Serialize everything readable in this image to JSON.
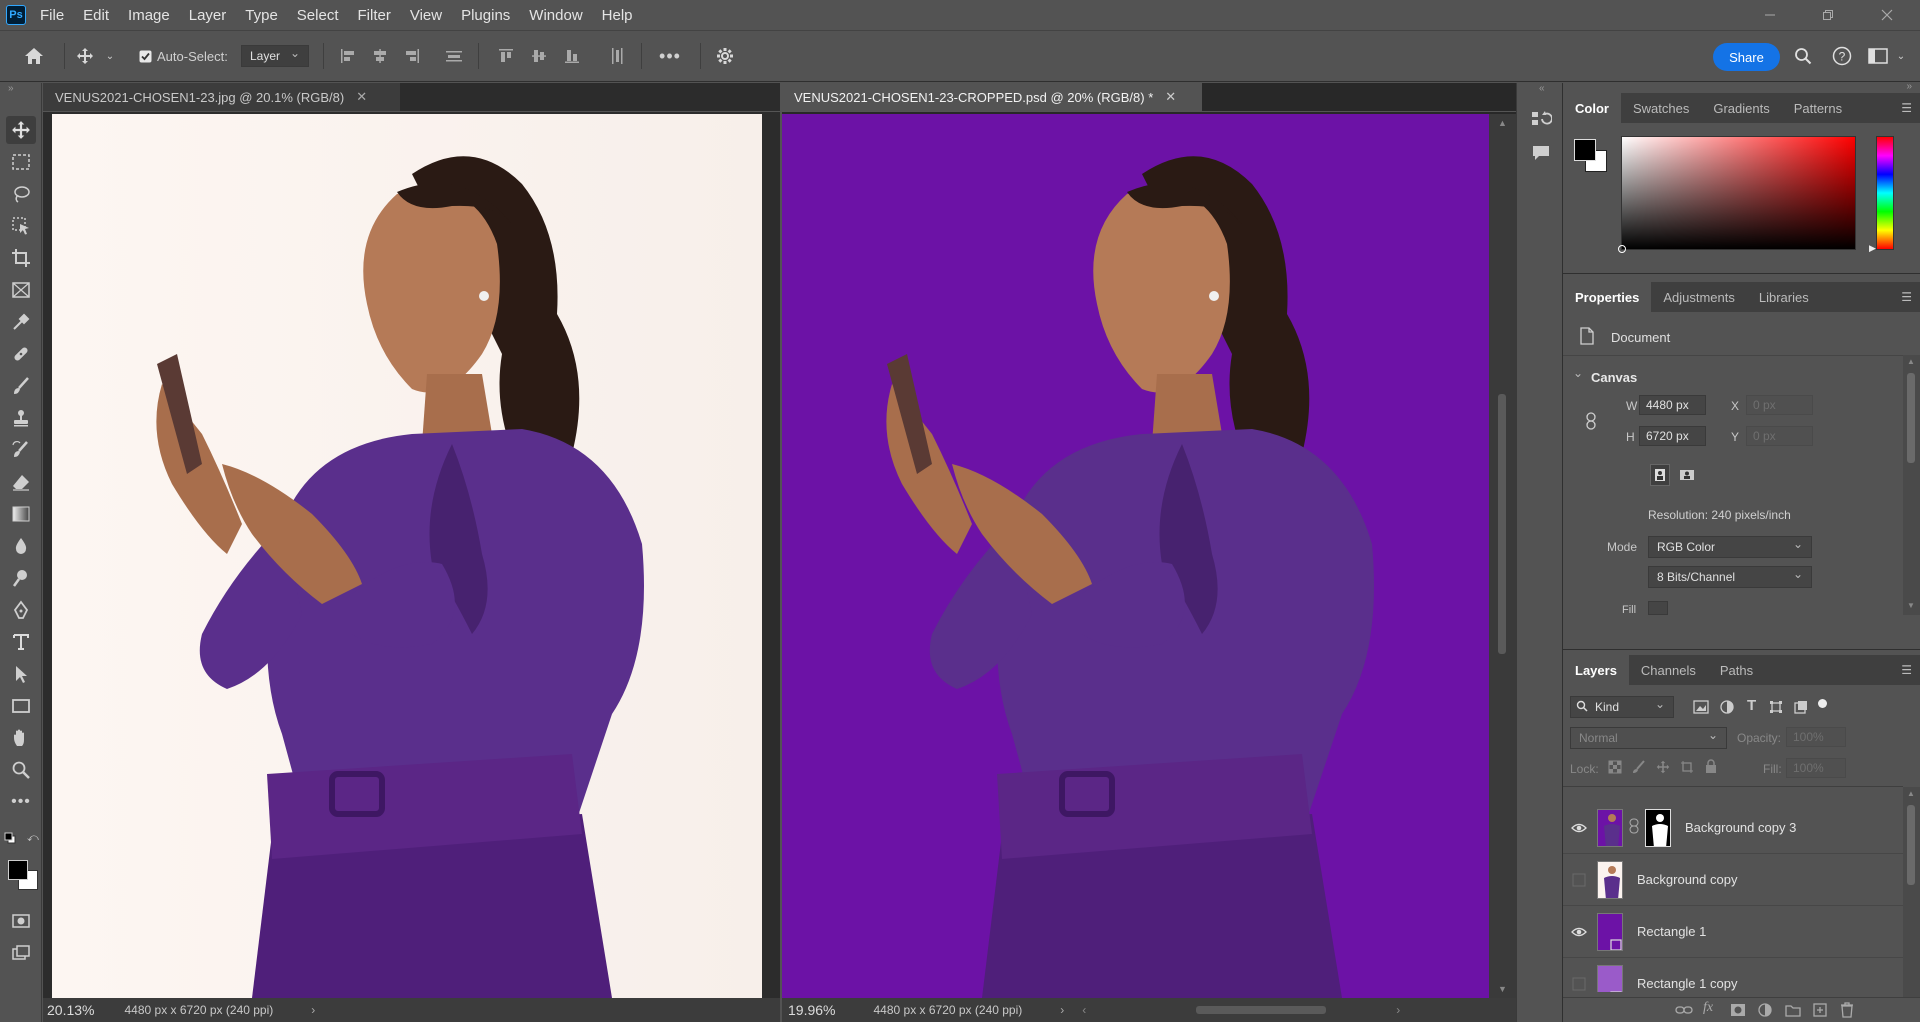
{
  "app": {
    "logo": "Ps"
  },
  "menu": [
    "File",
    "Edit",
    "Image",
    "Layer",
    "Type",
    "Select",
    "Filter",
    "View",
    "Plugins",
    "Window",
    "Help"
  ],
  "options_bar": {
    "auto_select_label": "Auto-Select:",
    "auto_select_checked": true,
    "auto_select_target": "Layer",
    "share_label": "Share"
  },
  "documents": [
    {
      "tab_title": "VENUS2021-CHOSEN1-23.jpg @ 20.1% (RGB/8)",
      "zoom": "20.13%",
      "info": "4480 px x 6720 px (240 ppi)",
      "active": false,
      "background": "#fbf3ef"
    },
    {
      "tab_title": "VENUS2021-CHOSEN1-23-CROPPED.psd @ 20% (RGB/8) *",
      "zoom": "19.96%",
      "info": "4480 px x 6720 px (240 ppi)",
      "active": true,
      "background": "#6c12a6"
    }
  ],
  "color_panel": {
    "tabs": [
      "Color",
      "Swatches",
      "Gradients",
      "Patterns"
    ],
    "active_tab": "Color",
    "foreground": "#000000",
    "background": "#ffffff",
    "hue_color": "#ff0000"
  },
  "properties_panel": {
    "tabs": [
      "Properties",
      "Adjustments",
      "Libraries"
    ],
    "active_tab": "Properties",
    "document_label": "Document",
    "canvas_section": "Canvas",
    "w_label": "W",
    "w_value": "4480 px",
    "h_label": "H",
    "h_value": "6720 px",
    "x_label": "X",
    "x_placeholder": "0 px",
    "y_label": "Y",
    "y_placeholder": "0 px",
    "resolution": "Resolution: 240 pixels/inch",
    "mode_label": "Mode",
    "mode_value": "RGB Color",
    "bits_value": "8 Bits/Channel",
    "fill_label": "Fill"
  },
  "layers_panel": {
    "tabs": [
      "Layers",
      "Channels",
      "Paths"
    ],
    "active_tab": "Layers",
    "filter_kind": "Kind",
    "blend_mode": "Normal",
    "opacity_label": "Opacity:",
    "opacity_value": "100%",
    "lock_label": "Lock:",
    "fill_label": "Fill:",
    "fill_value": "100%",
    "layers": [
      {
        "name": "Background copy 3",
        "visible": true,
        "has_mask": true,
        "thumb": "photo-purple"
      },
      {
        "name": "Background copy",
        "visible": false,
        "has_mask": false,
        "thumb": "photo-white"
      },
      {
        "name": "Rectangle 1",
        "visible": true,
        "has_mask": false,
        "thumb": "#6c12a6"
      },
      {
        "name": "Rectangle 1 copy",
        "visible": false,
        "has_mask": false,
        "thumb": "#9a5bc9"
      }
    ]
  }
}
